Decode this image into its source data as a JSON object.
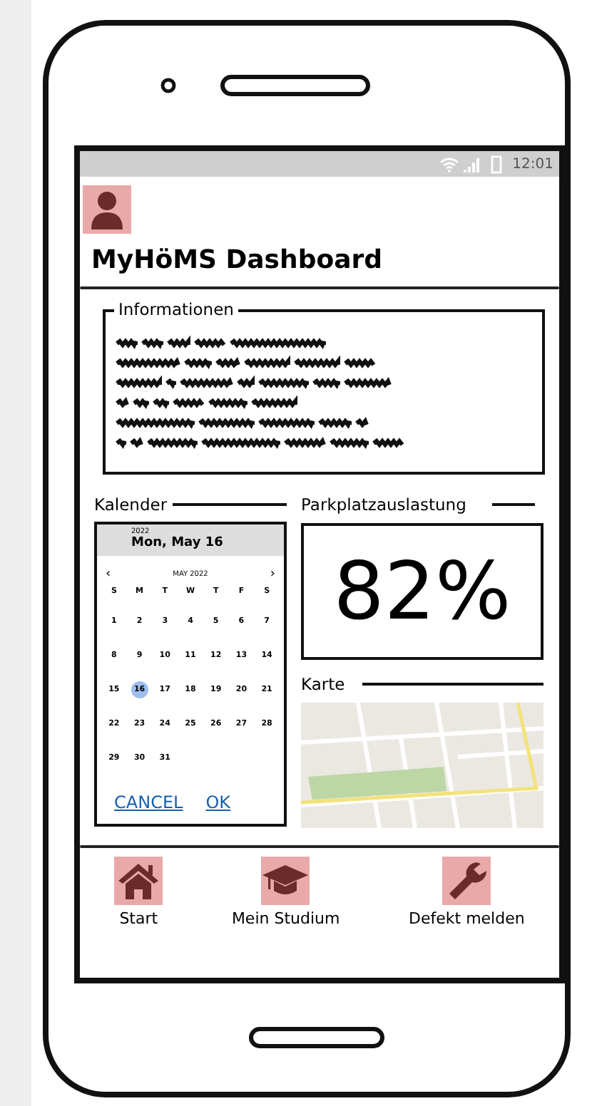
{
  "status_bar": {
    "time": "12:01"
  },
  "title": "MyHöMS Dashboard",
  "info": {
    "label": "Informationen"
  },
  "calendar": {
    "label": "Kalender",
    "year": "2022",
    "date": "Mon, May 16",
    "month": "MAY 2022",
    "prev": "‹",
    "next": "›",
    "weekdays": [
      "S",
      "M",
      "T",
      "W",
      "T",
      "F",
      "S"
    ],
    "days": [
      {
        "label": "1",
        "selected": false
      },
      {
        "label": "2",
        "selected": false
      },
      {
        "label": "3",
        "selected": false
      },
      {
        "label": "4",
        "selected": false
      },
      {
        "label": "5",
        "selected": false
      },
      {
        "label": "6",
        "selected": false
      },
      {
        "label": "7",
        "selected": false
      },
      {
        "label": "8",
        "selected": false
      },
      {
        "label": "9",
        "selected": false
      },
      {
        "label": "10",
        "selected": false
      },
      {
        "label": "11",
        "selected": false
      },
      {
        "label": "12",
        "selected": false
      },
      {
        "label": "13",
        "selected": false
      },
      {
        "label": "14",
        "selected": false
      },
      {
        "label": "15",
        "selected": false
      },
      {
        "label": "16",
        "selected": true
      },
      {
        "label": "17",
        "selected": false
      },
      {
        "label": "18",
        "selected": false
      },
      {
        "label": "19",
        "selected": false
      },
      {
        "label": "20",
        "selected": false
      },
      {
        "label": "21",
        "selected": false
      },
      {
        "label": "22",
        "selected": false
      },
      {
        "label": "23",
        "selected": false
      },
      {
        "label": "24",
        "selected": false
      },
      {
        "label": "25",
        "selected": false
      },
      {
        "label": "26",
        "selected": false
      },
      {
        "label": "27",
        "selected": false
      },
      {
        "label": "28",
        "selected": false
      },
      {
        "label": "29",
        "selected": false
      },
      {
        "label": "30",
        "selected": false
      },
      {
        "label": "31",
        "selected": false
      }
    ],
    "buttons": [
      "CANCEL",
      "OK"
    ]
  },
  "parking": {
    "label": "Parkplatzauslastung",
    "value": "82%"
  },
  "map": {
    "label": "Karte",
    "kind": "picture"
  },
  "nav": [
    {
      "label": "Start",
      "kind": "home"
    },
    {
      "label": "Mein Studium",
      "kind": "cap"
    },
    {
      "label": "Defekt melden",
      "kind": "wrench"
    }
  ]
}
